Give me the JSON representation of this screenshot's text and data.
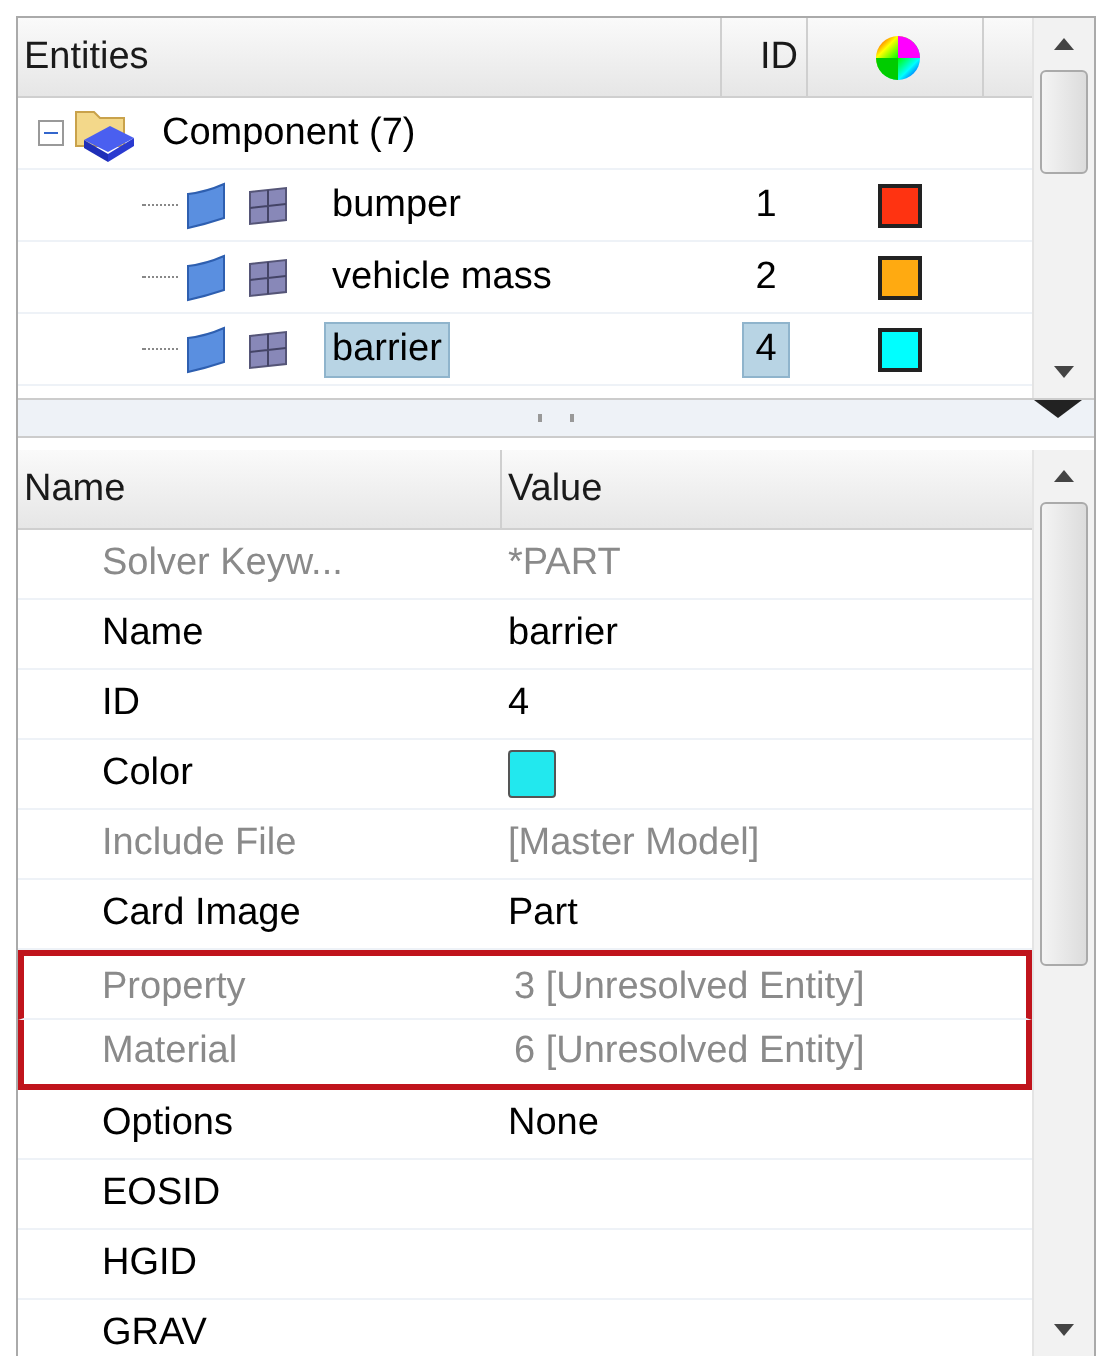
{
  "entities": {
    "columns": [
      "Entities",
      "ID"
    ],
    "tree": [
      {
        "label": "Component (7)",
        "expanded": true,
        "children": [
          {
            "name": "bumper",
            "id": "1",
            "color": "#ff3311",
            "selected": false
          },
          {
            "name": "vehicle mass",
            "id": "2",
            "color": "#ffaa11",
            "selected": false
          },
          {
            "name": "barrier",
            "id": "4",
            "color": "#00ffff",
            "selected": true
          }
        ]
      }
    ]
  },
  "properties": {
    "columns": [
      "Name",
      "Value"
    ],
    "rows": [
      {
        "name": "Solver Keyw...",
        "value": "*PART",
        "dimmed": true,
        "flagged": false
      },
      {
        "name": "Name",
        "value": "barrier",
        "dimmed": false,
        "flagged": false
      },
      {
        "name": "ID",
        "value": "4",
        "dimmed": false,
        "flagged": false
      },
      {
        "name": "Color",
        "kind": "swatch",
        "color": "#22e8ee",
        "dimmed": false,
        "flagged": false
      },
      {
        "name": "Include File",
        "value": "[Master Model]",
        "dimmed": true,
        "flagged": false
      },
      {
        "name": "Card Image",
        "value": "Part",
        "dimmed": false,
        "flagged": false
      },
      {
        "name": "Property",
        "value": "3 [Unresolved Entity]",
        "dimmed": true,
        "flagged": true
      },
      {
        "name": "Material",
        "value": "6 [Unresolved Entity]",
        "dimmed": true,
        "flagged": true
      },
      {
        "name": "Options",
        "value": "None",
        "dimmed": false,
        "flagged": false
      },
      {
        "name": "EOSID",
        "dimmed": false,
        "flagged": false
      },
      {
        "name": "HGID",
        "dimmed": false,
        "flagged": false
      },
      {
        "name": "GRAV",
        "dimmed": false,
        "flagged": false
      }
    ]
  }
}
